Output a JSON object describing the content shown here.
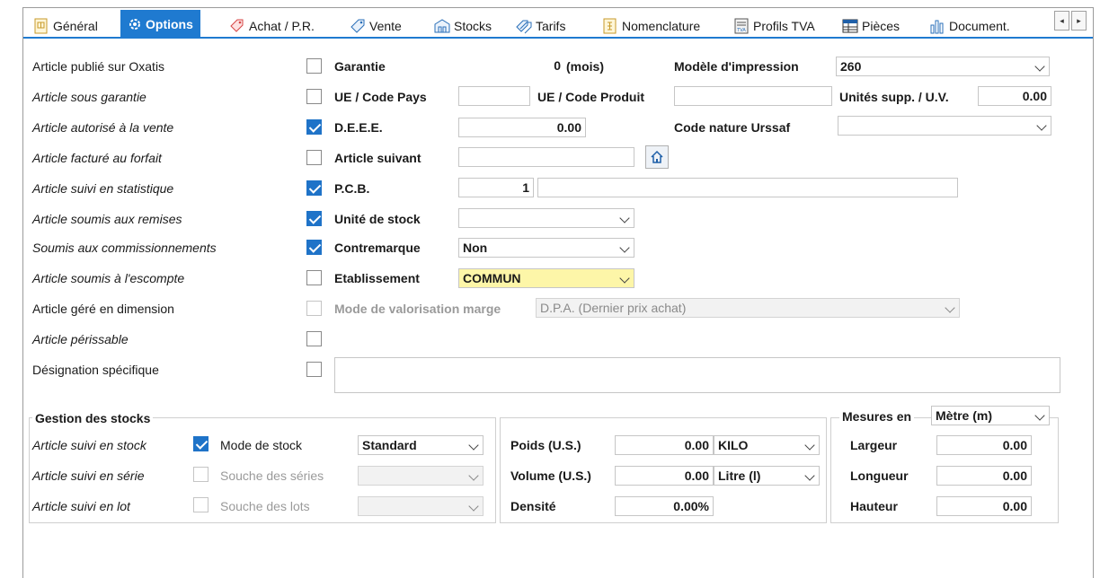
{
  "tabs": [
    {
      "label": "Général",
      "icon": "document-grid-icon"
    },
    {
      "label": "Options",
      "icon": "gear-icon",
      "active": true
    },
    {
      "label": "Achat / P.R.",
      "icon": "tag-search-icon"
    },
    {
      "label": "Vente",
      "icon": "price-tag-icon"
    },
    {
      "label": "Stocks",
      "icon": "warehouse-icon"
    },
    {
      "label": "Tarifs",
      "icon": "tags-icon"
    },
    {
      "label": "Nomenclature",
      "icon": "tree-icon"
    },
    {
      "label": "Profils TVA",
      "icon": "tva-icon"
    },
    {
      "label": "Pièces",
      "icon": "table-icon"
    },
    {
      "label": "Document.",
      "icon": "bar-chart-icon"
    }
  ],
  "tab_scroll": {
    "left": "◂",
    "right": "▸"
  },
  "left_options": [
    {
      "label": "Article publié sur Oxatis",
      "italic": false,
      "checked": false
    },
    {
      "label": "Article sous garantie",
      "italic": true,
      "checked": false
    },
    {
      "label": "Article autorisé à la vente",
      "italic": true,
      "checked": true
    },
    {
      "label": "Article facturé au forfait",
      "italic": true,
      "checked": false
    },
    {
      "label": "Article suivi en statistique",
      "italic": true,
      "checked": true
    },
    {
      "label": "Article soumis aux remises",
      "italic": true,
      "checked": true
    },
    {
      "label": "Soumis aux commissionnements",
      "italic": true,
      "checked": true
    },
    {
      "label": "Article soumis à l'escompte",
      "italic": true,
      "checked": false
    },
    {
      "label": "Article géré en dimension",
      "italic": false,
      "checked": false,
      "disabled": true
    },
    {
      "label": "Article périssable",
      "italic": true,
      "checked": false
    },
    {
      "label": "Désignation spécifique",
      "italic": false,
      "checked": false
    }
  ],
  "mid": {
    "garantie_label": "Garantie",
    "garantie_value": "0",
    "garantie_unit": "(mois)",
    "ue_pays_label": "UE / Code Pays",
    "ue_pays_value": "",
    "ue_produit_label": "UE / Code Produit",
    "ue_produit_value": "",
    "deee_label": "D.E.E.E.",
    "deee_value": "0.00",
    "suivant_label": "Article suivant",
    "suivant_value": "",
    "pcb_label": "P.C.B.",
    "pcb_value": "1",
    "pcb_extra": "",
    "unite_label": "Unité de stock",
    "unite_value": "",
    "contremarque_label": "Contremarque",
    "contremarque_value": "Non",
    "etab_label": "Etablissement",
    "etab_value": "COMMUN",
    "valorisation_label": "Mode de valorisation marge",
    "valorisation_value": "D.P.A. (Dernier prix achat)",
    "designation_value": ""
  },
  "right": {
    "modele_label": "Modèle d'impression",
    "modele_value": "260",
    "unites_label": "Unités supp. / U.V.",
    "unites_value": "0.00",
    "urssaf_label": "Code nature Urssaf",
    "urssaf_value": ""
  },
  "stocks_group": {
    "title": "Gestion des stocks",
    "rows": [
      {
        "left": "Article suivi en stock",
        "checked": true,
        "label": "Mode de stock",
        "value": "Standard",
        "disabled": false
      },
      {
        "left": "Article suivi en série",
        "checked": false,
        "label": "Souche des séries",
        "value": "",
        "disabled": true
      },
      {
        "left": "Article suivi en lot",
        "checked": false,
        "label": "Souche des lots",
        "value": "",
        "disabled": true
      }
    ]
  },
  "physique": {
    "poids_label": "Poids (U.S.)",
    "poids_value": "0.00",
    "poids_unit": "KILO",
    "volume_label": "Volume (U.S.)",
    "volume_value": "0.00",
    "volume_unit": "Litre (l)",
    "densite_label": "Densité",
    "densite_value": "0.00%"
  },
  "mesures": {
    "title": "Mesures en",
    "unit": "Mètre (m)",
    "largeur_label": "Largeur",
    "largeur_value": "0.00",
    "longueur_label": "Longueur",
    "longueur_value": "0.00",
    "hauteur_label": "Hauteur",
    "hauteur_value": "0.00"
  },
  "colors": {
    "accent": "#1f7ad0",
    "checkbox": "#1f73c8",
    "highlight": "#fdf6a8"
  }
}
